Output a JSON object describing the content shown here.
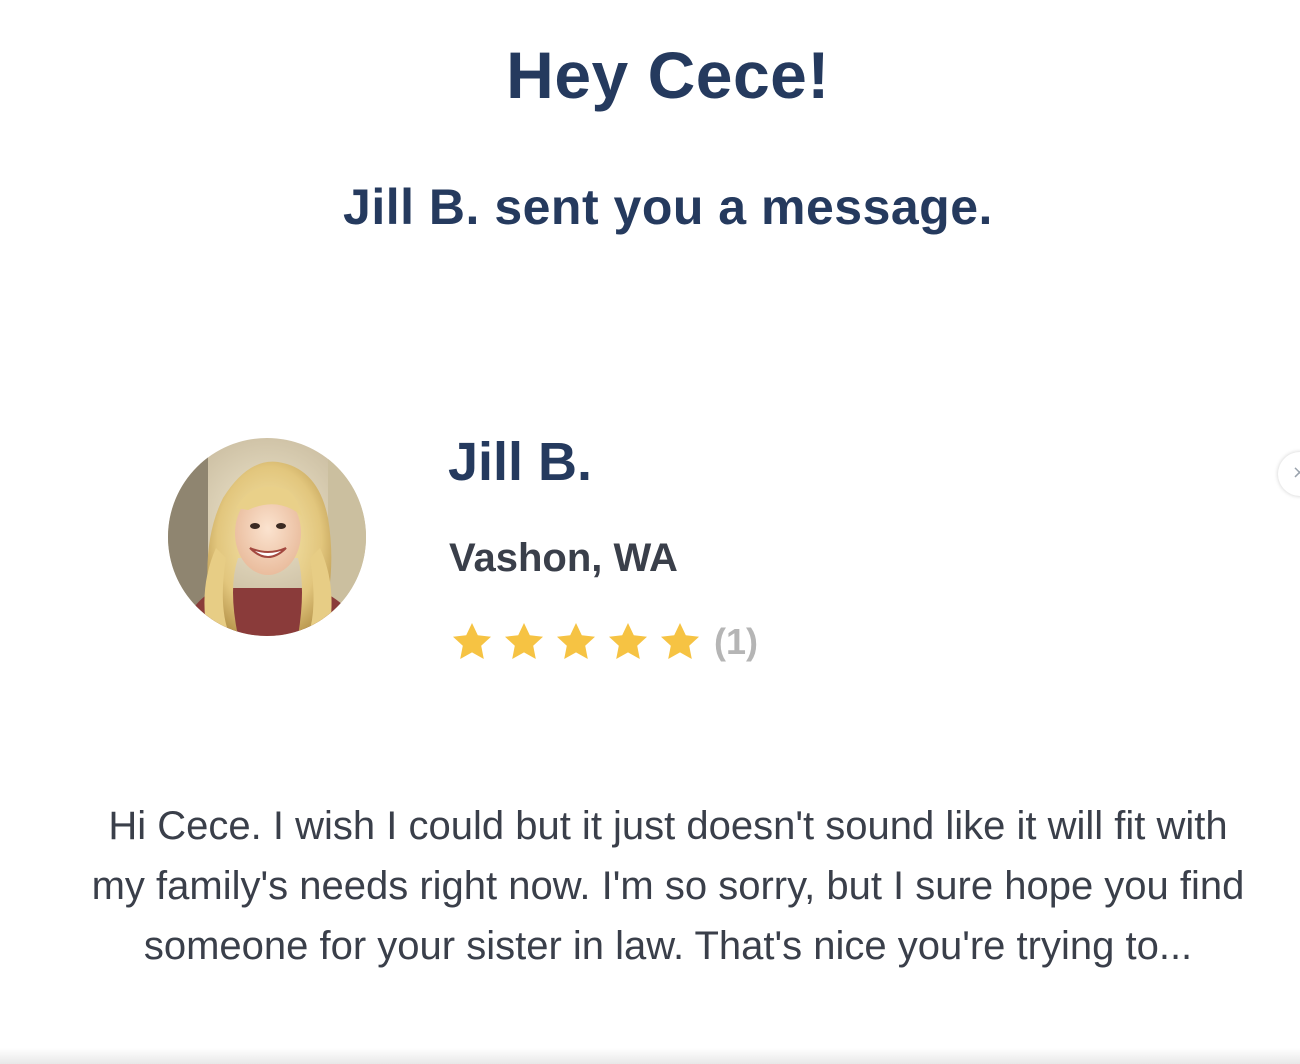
{
  "header": {
    "greeting": "Hey Cece!",
    "subheading": "Jill B. sent you a message."
  },
  "sender": {
    "avatar_icon": "avatar-photo",
    "name": "Jill B.",
    "location": "Vashon, WA",
    "rating": {
      "stars": 5,
      "max_stars": 5,
      "review_count": "(1)",
      "star_color": "#f6c343"
    }
  },
  "message": {
    "body": "Hi Cece. I wish I could but it just doesn't sound like it will fit with my family's needs right now. I'm so sorry, but I sure hope you find someone for your sister in law. That's nice you're trying to..."
  },
  "side_tab": {
    "icon": "close-icon",
    "glyph": "×"
  },
  "colors": {
    "heading": "#253a5e",
    "body_text": "#3a3f4a",
    "muted": "#b5b5b5",
    "background": "#ffffff"
  }
}
